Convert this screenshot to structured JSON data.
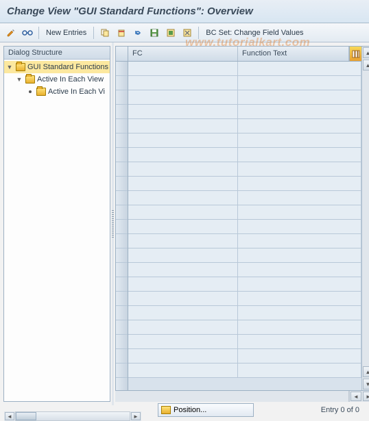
{
  "title": "Change View \"GUI Standard Functions\": Overview",
  "toolbar": {
    "new_entries": "New Entries",
    "bc_set": "BC Set: Change Field Values"
  },
  "left": {
    "header": "Dialog Structure",
    "tree": {
      "root": "GUI Standard Functions",
      "child1": "Active In Each View",
      "child2": "Active In Each Vi"
    }
  },
  "grid": {
    "col_fc": "FC",
    "col_ft": "Function Text"
  },
  "footer": {
    "position": "Position...",
    "entry": "Entry 0 of 0"
  },
  "watermark": "www.tutorialkart.com"
}
